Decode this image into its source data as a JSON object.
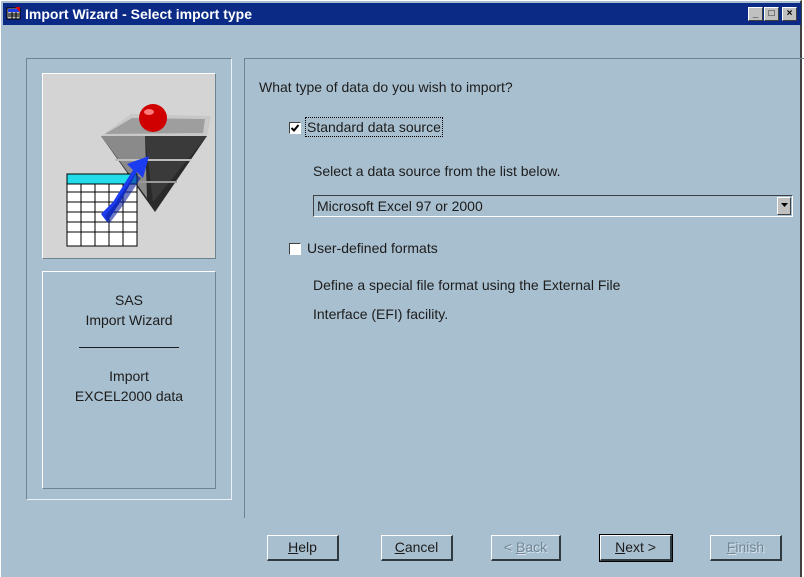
{
  "window": {
    "title": "Import Wizard - Select import type",
    "minimize_glyph": "_",
    "maximize_glyph": "□",
    "close_glyph": "×"
  },
  "sidebar": {
    "line1": "SAS",
    "line2": "Import Wizard",
    "line3": "Import",
    "line4": "EXCEL2000 data"
  },
  "main": {
    "question": "What type of data do you wish to import?",
    "standard": {
      "label": "Standard data source",
      "checked": true,
      "hint": "Select a data source from the list below.",
      "selected_source": "Microsoft Excel 97 or 2000"
    },
    "user_defined": {
      "label": "User-defined formats",
      "checked": false,
      "hint_line1": "Define a special file format using the External File",
      "hint_line2": "Interface (EFI) facility."
    }
  },
  "buttons": {
    "help": {
      "prefix": "",
      "underlined": "H",
      "suffix": "elp",
      "enabled": true
    },
    "cancel": {
      "prefix": "",
      "underlined": "C",
      "suffix": "ancel",
      "enabled": true
    },
    "back": {
      "prefix": "< ",
      "underlined": "B",
      "suffix": "ack",
      "enabled": false
    },
    "next": {
      "prefix": "",
      "underlined": "N",
      "suffix": "ext >",
      "enabled": true
    },
    "finish": {
      "prefix": "",
      "underlined": "F",
      "suffix": "inish",
      "enabled": false
    }
  },
  "colors": {
    "titlebar": "#0a2a86",
    "dialog_background": "#a8bfcf",
    "accent_red": "#e00000",
    "accent_blue": "#1c3cf0",
    "accent_cyan": "#22dcea"
  },
  "icons": [
    "app-icon",
    "minimize-icon",
    "maximize-icon",
    "close-icon",
    "import-wizard-illustration",
    "checkmark-icon",
    "dropdown-arrow-icon"
  ]
}
